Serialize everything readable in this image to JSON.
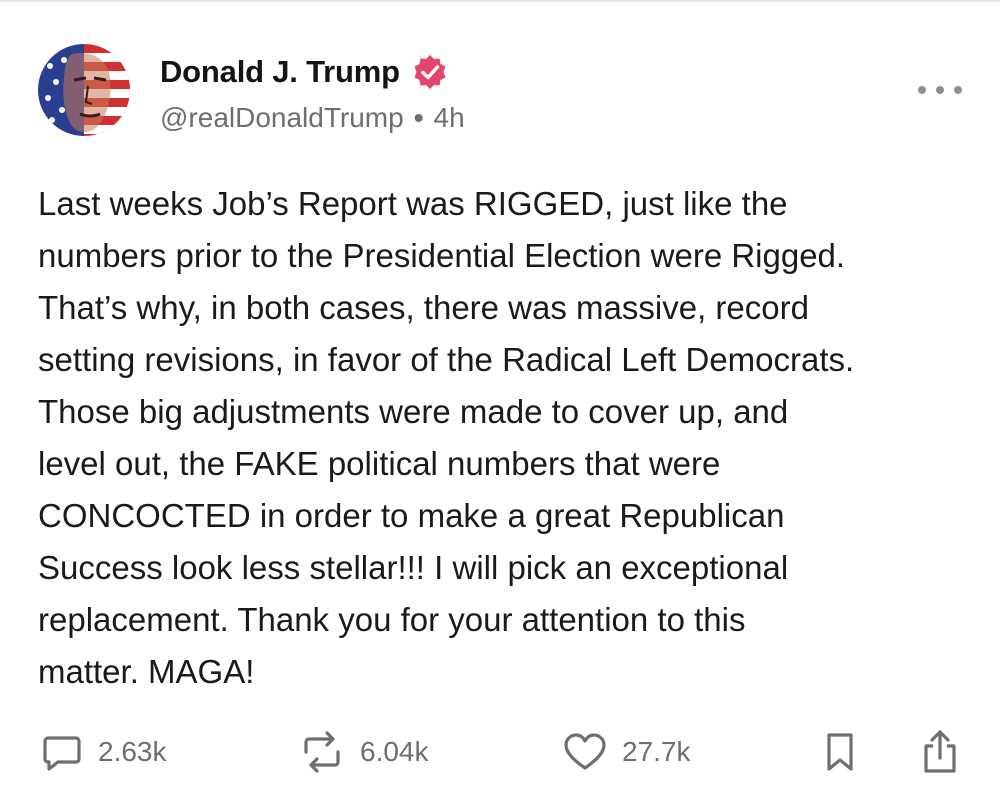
{
  "post": {
    "author": {
      "display_name": "Donald J. Trump",
      "handle": "@realDonaldTrump",
      "verified": true,
      "avatar": "portrait-american-flag"
    },
    "separator": "•",
    "time": "4h",
    "text": "Last weeks Job’s Report was RIGGED, just like the\nnumbers prior to the Presidential Election were Rigged.\nThat’s why, in both cases, there was massive, record\nsetting revisions, in favor of the Radical Left Democrats.\nThose big adjustments were made to cover up, and\nlevel out, the FAKE political numbers that were\nCONCOCTED in order to make a great Republican\nSuccess look less stellar!!! I will pick an exceptional\nreplacement. Thank you for your attention to this\nmatter. MAGA!",
    "stats": {
      "replies": "2.63k",
      "reposts": "6.04k",
      "likes": "27.7k"
    }
  },
  "icons": {
    "more": "more-horizontal-icon",
    "reply": "comment-bubble-icon",
    "repost": "repost-arrows-icon",
    "like": "heart-icon",
    "bookmark": "bookmark-icon",
    "share": "share-upload-icon",
    "verified": "verified-badge-icon"
  },
  "colors": {
    "verified_badge": "#e5466e",
    "text": "#1a1a1a",
    "muted": "#6e6e6e"
  }
}
